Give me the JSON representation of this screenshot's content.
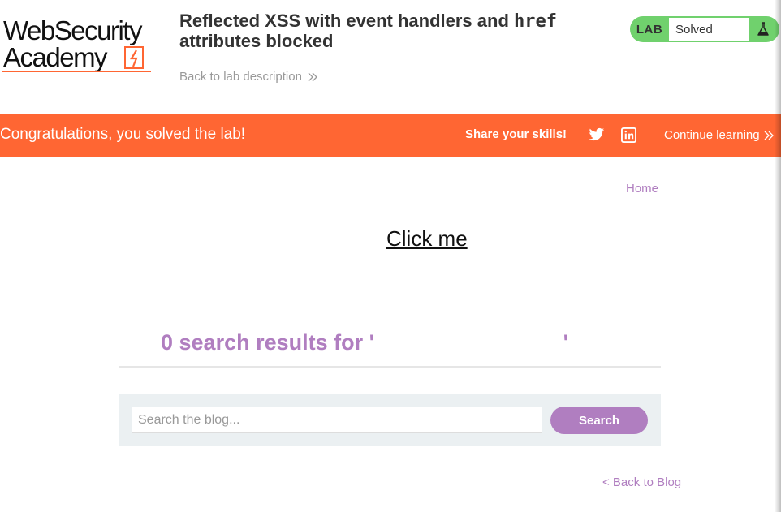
{
  "header": {
    "logo": {
      "line1": "WebSecurity",
      "line2": "Academy"
    },
    "title_prefix": "Reflected XSS with event handlers and ",
    "title_code": "href",
    "title_suffix": " attributes blocked",
    "back_link": "Back to lab description",
    "lab_badge": "LAB",
    "lab_status": "Solved",
    "colors": {
      "status_green": "#70d16d",
      "accent_orange": "#ff6633"
    }
  },
  "banner": {
    "message": "Congratulations, you solved the lab!",
    "share_label": "Share your skills!",
    "twitter_icon": "twitter-icon",
    "linkedin_icon": "linkedin-icon",
    "continue_label": "Continue learning"
  },
  "nav": {
    "home": "Home"
  },
  "content": {
    "click_me": "Click me",
    "results_text": "0 search results for '                               '",
    "search_placeholder": "Search the blog...",
    "search_button": "Search",
    "back_to_blog": "< Back to Blog",
    "colors": {
      "link_purple": "#b07ec0",
      "search_bg": "#ebf0f2"
    }
  }
}
